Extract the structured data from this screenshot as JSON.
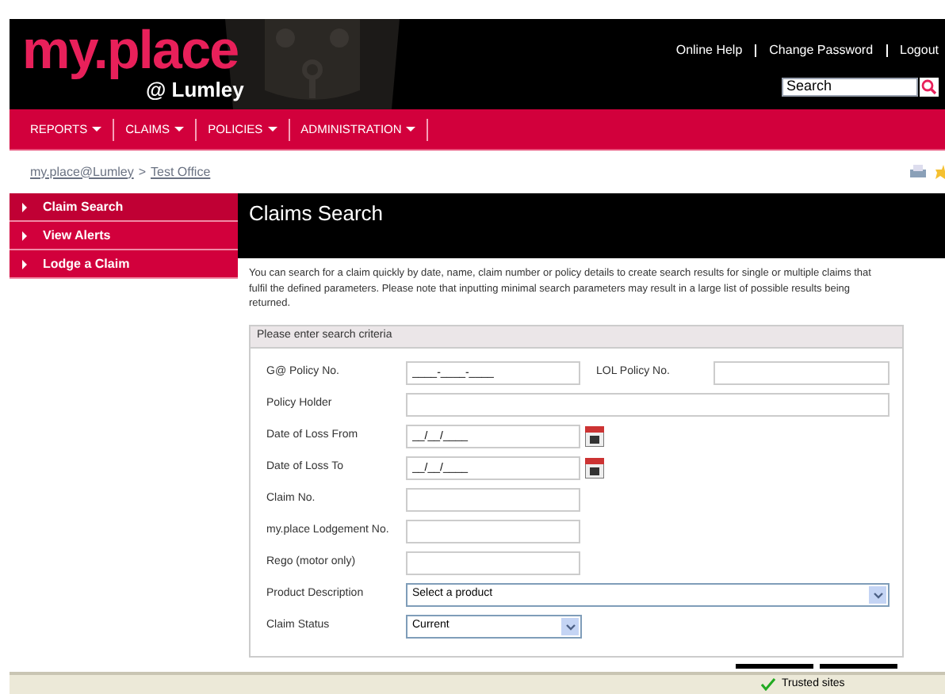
{
  "header": {
    "logo": "my.place",
    "logo_sub": "@ Lumley",
    "links": [
      "Online Help",
      "Change Password",
      "Logout"
    ],
    "search": {
      "value": "Search"
    }
  },
  "nav": [
    "REPORTS",
    "CLAIMS",
    "POLICIES",
    "ADMINISTRATION"
  ],
  "breadcrumb": {
    "links": [
      "my.place@Lumley",
      "Test Office"
    ],
    "separator": ">"
  },
  "sidebar": {
    "items": [
      {
        "label": "Claim Search",
        "selected": true
      },
      {
        "label": "View Alerts",
        "selected": false
      },
      {
        "label": "Lodge a Claim",
        "selected": false
      }
    ]
  },
  "page": {
    "title": "Claims Search",
    "intro": "You can search for a claim quickly by date, name, claim number or policy details to create search results for single or multiple claims that fulfil the defined parameters. Please note that inputting minimal search parameters may result in a large list of possible results being returned."
  },
  "form": {
    "heading": "Please enter search criteria",
    "rows": [
      {
        "label": "G@ Policy No.",
        "kind": "text",
        "value": "____-____-____",
        "second_label": "LOL Policy No."
      },
      {
        "label": "Policy Holder",
        "kind": "wide"
      },
      {
        "label": "Date of Loss From",
        "kind": "date",
        "value": "__/__/____"
      },
      {
        "label": "Date of Loss To",
        "kind": "date",
        "value": "__/__/____"
      },
      {
        "label": "Claim No.",
        "kind": "text"
      },
      {
        "label": "my.place Lodgement No.",
        "kind": "text"
      },
      {
        "label": "Rego (motor only)",
        "kind": "text"
      },
      {
        "label": "Product Description",
        "kind": "wideselect",
        "value": "Select a product"
      },
      {
        "label": "Claim Status",
        "kind": "select",
        "value": "Current"
      }
    ]
  },
  "status_bar": {
    "zone": "Trusted sites"
  }
}
